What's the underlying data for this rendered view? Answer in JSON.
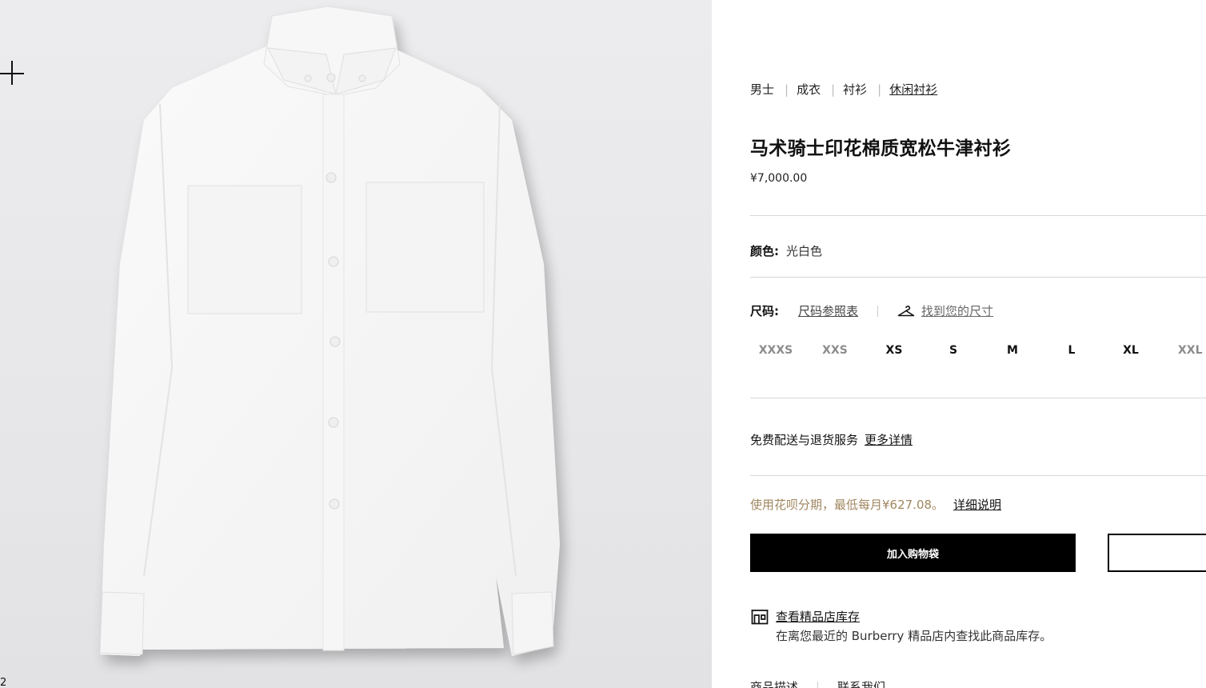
{
  "gallery": {
    "image_index": "2",
    "zoom_icon": "plus-icon"
  },
  "breadcrumb": [
    "男士",
    "成衣",
    "衬衫",
    "休闲衬衫"
  ],
  "product": {
    "title": "马术骑士印花棉质宽松牛津衬衫",
    "price": "¥7,000.00"
  },
  "color": {
    "label": "颜色:",
    "value": "光白色"
  },
  "size": {
    "label": "尺码:",
    "chart_link": "尺码参照表",
    "finder_icon": "hanger-icon",
    "finder_link": "找到您的尺寸",
    "options": [
      {
        "label": "XXXS",
        "available": false
      },
      {
        "label": "XXS",
        "available": false
      },
      {
        "label": "XS",
        "available": true
      },
      {
        "label": "S",
        "available": true
      },
      {
        "label": "M",
        "available": true
      },
      {
        "label": "L",
        "available": true
      },
      {
        "label": "XL",
        "available": true
      },
      {
        "label": "XXL",
        "available": false
      }
    ]
  },
  "shipping": {
    "text": "免费配送与退货服务",
    "link": "更多详情"
  },
  "installment": {
    "text": "使用花呗分期，最低每月¥627.08。",
    "link": "详细说明",
    "color": "#a08760"
  },
  "actions": {
    "add_to_bag": "加入购物袋"
  },
  "store": {
    "icon": "store-icon",
    "title": "查看精品店库存",
    "desc": "在离您最近的 Burberry 精品店内查找此商品库存。"
  },
  "bottom_tabs": [
    "商品描述",
    "联系我们"
  ]
}
